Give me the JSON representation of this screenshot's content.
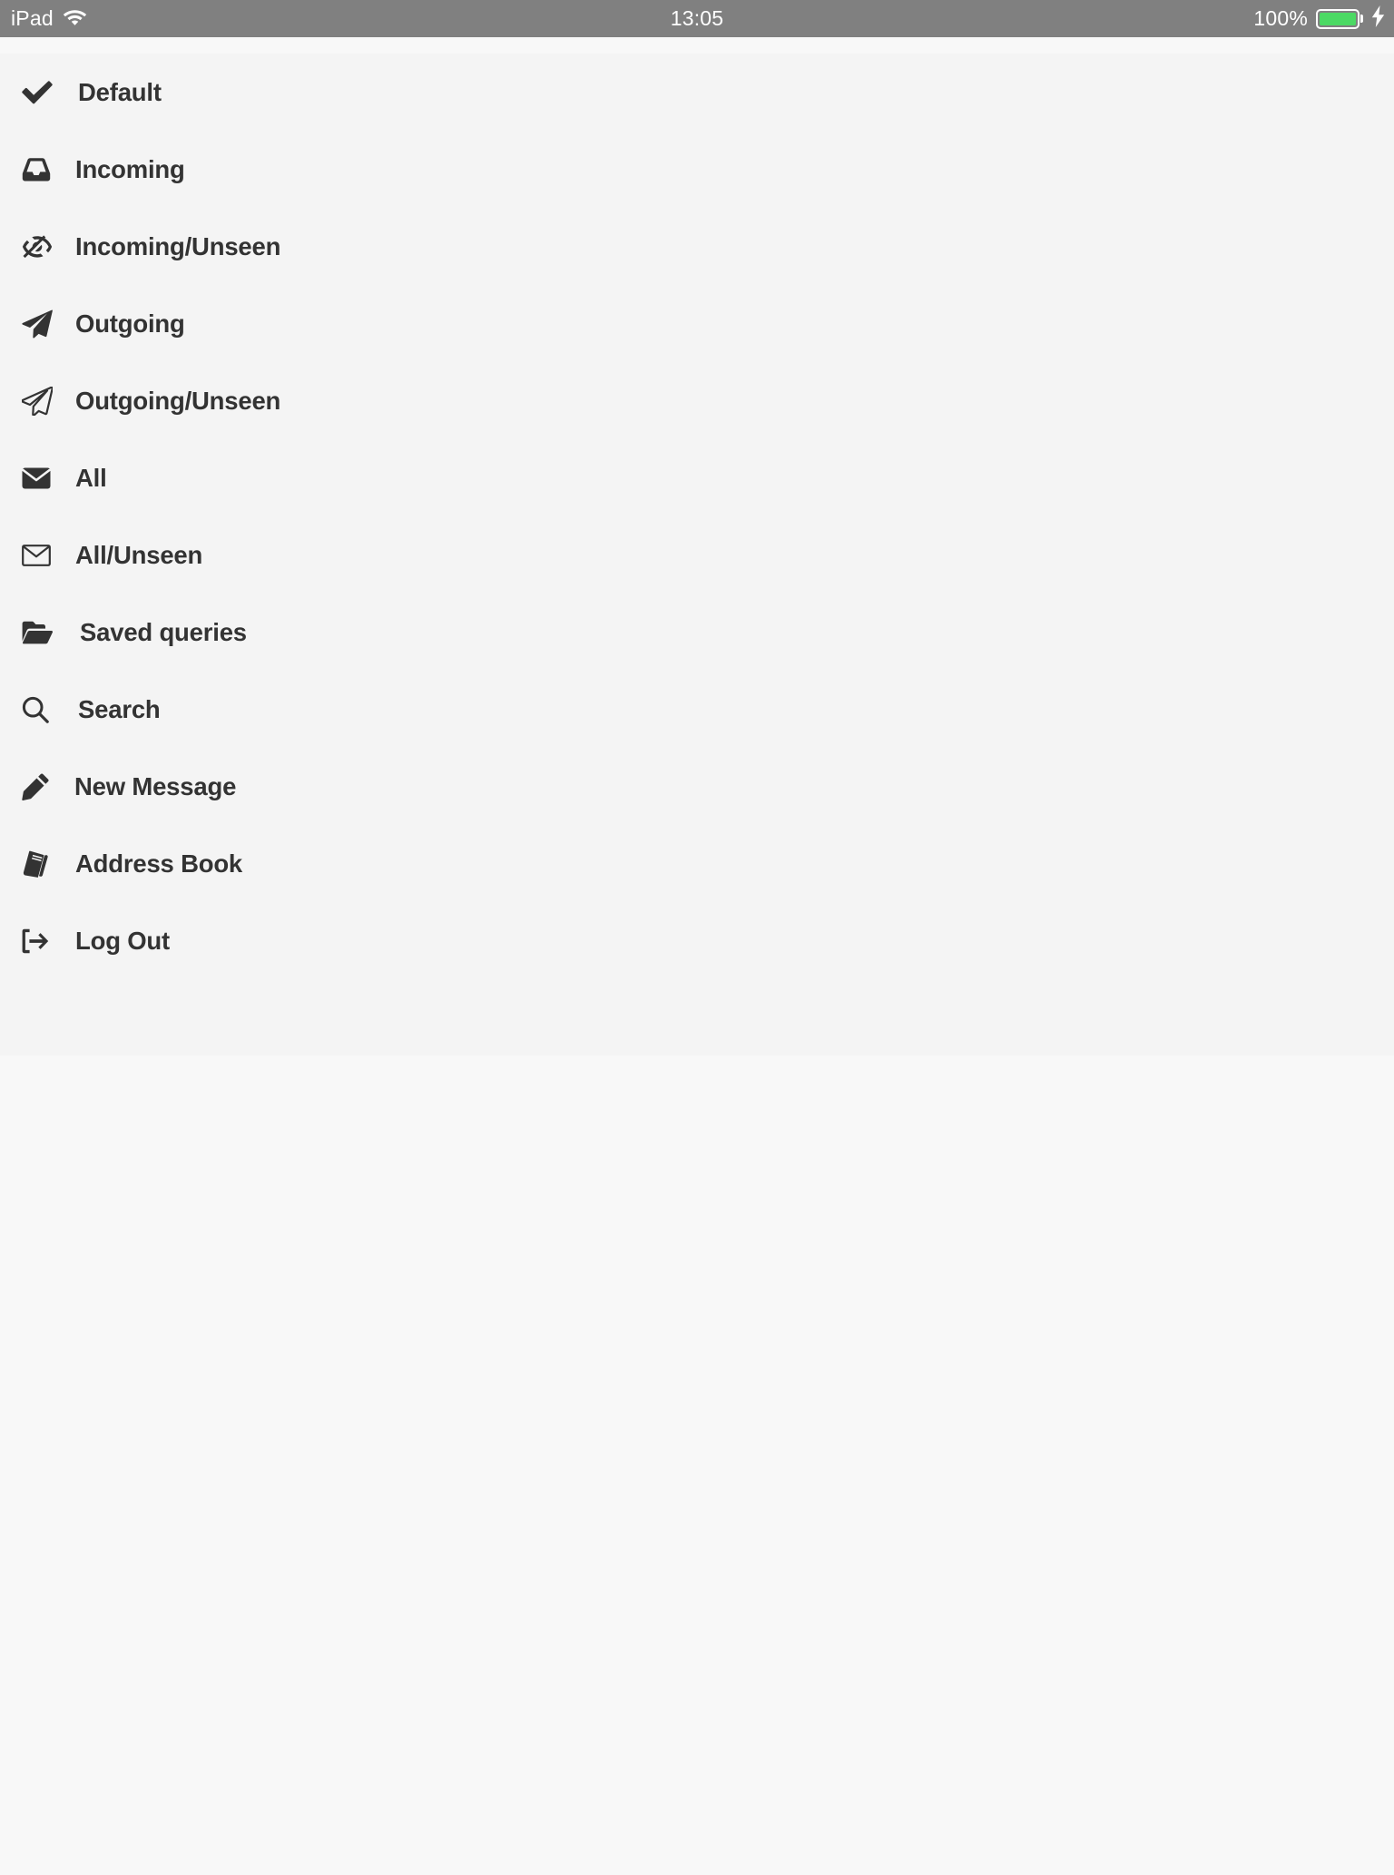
{
  "status_bar": {
    "device_label": "iPad",
    "wifi_icon": "wifi-icon",
    "time": "13:05",
    "battery_percent": "100%",
    "battery_icon": "battery-full-icon",
    "charging_icon": "lightning-bolt-icon",
    "background_color": "#808080",
    "text_color": "#ffffff",
    "battery_fill_color": "#4cd964"
  },
  "menu": {
    "background_color": "#f4f4f4",
    "text_color": "#333333",
    "items": [
      {
        "label": "Default",
        "icon": "check-icon"
      },
      {
        "label": "Incoming",
        "icon": "inbox-icon"
      },
      {
        "label": "Incoming/Unseen",
        "icon": "eye-slash-icon"
      },
      {
        "label": "Outgoing",
        "icon": "paper-plane-filled-icon"
      },
      {
        "label": "Outgoing/Unseen",
        "icon": "paper-plane-outline-icon"
      },
      {
        "label": "All",
        "icon": "envelope-filled-icon"
      },
      {
        "label": "All/Unseen",
        "icon": "envelope-outline-icon"
      },
      {
        "label": "Saved queries",
        "icon": "folder-open-icon"
      },
      {
        "label": "Search",
        "icon": "search-icon"
      },
      {
        "label": "New Message",
        "icon": "pencil-icon"
      },
      {
        "label": "Address Book",
        "icon": "book-icon"
      },
      {
        "label": "Log Out",
        "icon": "sign-out-icon"
      }
    ]
  },
  "content_area": {
    "background_color": "#f8f8f8"
  }
}
